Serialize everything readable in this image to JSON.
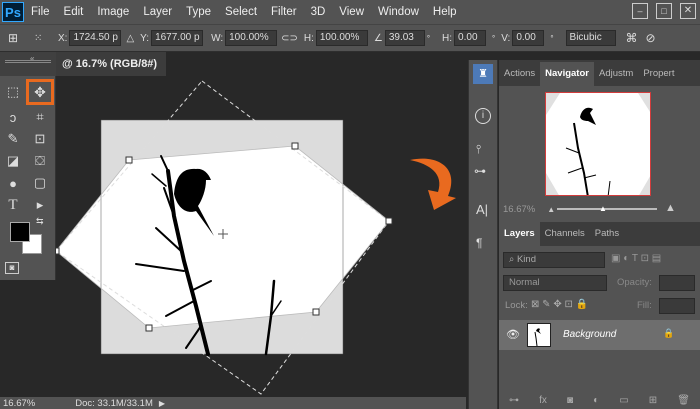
{
  "menubar": {
    "logo": "Ps",
    "items": [
      "File",
      "Edit",
      "Image",
      "Layer",
      "Type",
      "Select",
      "Filter",
      "3D",
      "View",
      "Window",
      "Help"
    ]
  },
  "options": {
    "x_label": "X:",
    "x_value": "1724.50 p",
    "y_label": "Y:",
    "y_value": "1677.00 p",
    "w_label": "W:",
    "w_value": "100.00%",
    "h_label": "H:",
    "h_value": "100.00%",
    "angle_value": "39.03",
    "hskew_label": "H:",
    "hskew_value": "0.00",
    "vskew_label": "V:",
    "vskew_value": "0.00",
    "interpolation": "Bicubic"
  },
  "document": {
    "tab_title": "@ 16.7% (RGB/8#)"
  },
  "status": {
    "zoom": "16.67%",
    "doc": "Doc: 33.1M/33.1M"
  },
  "panels": {
    "top_tabs": [
      "Actions",
      "Navigator",
      "Adjustm",
      "Propert"
    ],
    "nav_zoom": "16.67%",
    "layer_tabs": [
      "Layers",
      "Channels",
      "Paths"
    ],
    "kind_label": "Kind",
    "blend_mode": "Normal",
    "opacity_label": "Opacity:",
    "lock_label": "Lock:",
    "fill_label": "Fill:",
    "layer_name": "Background"
  },
  "colors": {
    "highlight": "#e96a1f",
    "navigator_border": "#d23c3c"
  }
}
